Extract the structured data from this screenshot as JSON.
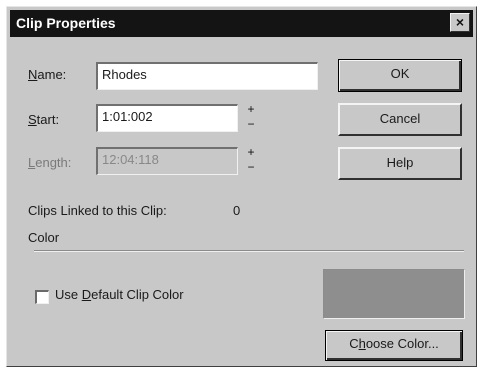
{
  "window": {
    "title": "Clip Properties",
    "close_glyph": "×"
  },
  "fields": {
    "name": {
      "label_pre": "",
      "label_u": "N",
      "label_post": "ame:",
      "value": "Rhodes"
    },
    "start": {
      "label_pre": "",
      "label_u": "S",
      "label_post": "tart:",
      "value": "1:01:002"
    },
    "length": {
      "label_pre": "",
      "label_u": "L",
      "label_post": "ength:",
      "value": "12:04:118",
      "disabled": true
    }
  },
  "spinner": {
    "up_glyph": "+",
    "down_glyph": "−"
  },
  "buttons": {
    "ok": "OK",
    "cancel": "Cancel",
    "help": "Help",
    "choose_color_pre": "C",
    "choose_color_u": "h",
    "choose_color_post": "oose Color..."
  },
  "linked": {
    "label": "Clips Linked to this Clip:",
    "count": "0"
  },
  "color_section": {
    "heading": "Color",
    "checkbox_pre": "Use ",
    "checkbox_u": "D",
    "checkbox_post": "efault Clip Color",
    "checked": false,
    "swatch_color": "#8e8e8e"
  },
  "icons": {
    "close": "close-icon",
    "spin_up": "plus-icon",
    "spin_down": "minus-icon"
  }
}
